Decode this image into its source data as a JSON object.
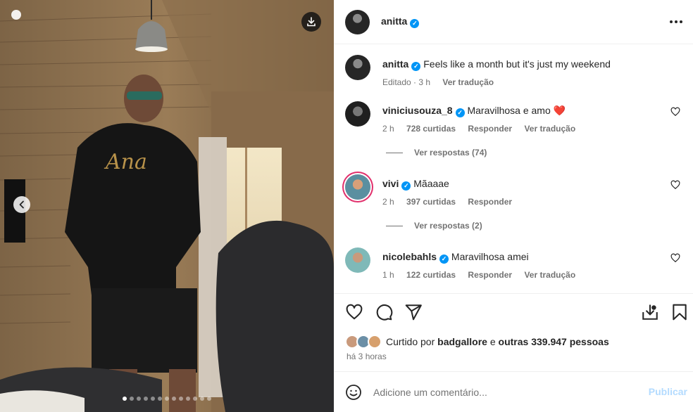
{
  "post": {
    "author": "anitta",
    "verified": true,
    "caption": "Feels like a month but it's just my weekend",
    "caption_meta": {
      "edited": "Editado · 3 h",
      "translate": "Ver tradução"
    }
  },
  "media": {
    "icons": {
      "download": "download-icon",
      "previous": "chevron-left-icon"
    },
    "carousel_dots": 13,
    "active_dot": 0
  },
  "comments": [
    {
      "username": "viniciusouza_8",
      "text": "Maravilhosa e amo",
      "emoji": "❤️",
      "time": "2 h",
      "likes": "728 curtidas",
      "reply": "Responder",
      "translate": "Ver tradução",
      "view_replies": "Ver respostas (74)"
    },
    {
      "username": "vivi",
      "text": "Mãaaae",
      "time": "2 h",
      "likes": "397 curtidas",
      "reply": "Responder",
      "view_replies": "Ver respostas (2)"
    },
    {
      "username": "nicolebahls",
      "text": "Maravilhosa amei",
      "time": "1 h",
      "likes": "122 curtidas",
      "reply": "Responder",
      "translate": "Ver tradução"
    }
  ],
  "likes_summary": {
    "prefix": "Curtido por",
    "user": "badgallore",
    "connector": "e",
    "others": "outras 339.947 pessoas"
  },
  "posted_time": "há 3 horas",
  "add_comment": {
    "placeholder": "Adicione um comentário...",
    "publish": "Publicar"
  },
  "colors": {
    "verified": "#0095f6",
    "like_red": "#ed4956",
    "publish_disabled": "#b3dbff",
    "secondary_text": "#737373"
  }
}
